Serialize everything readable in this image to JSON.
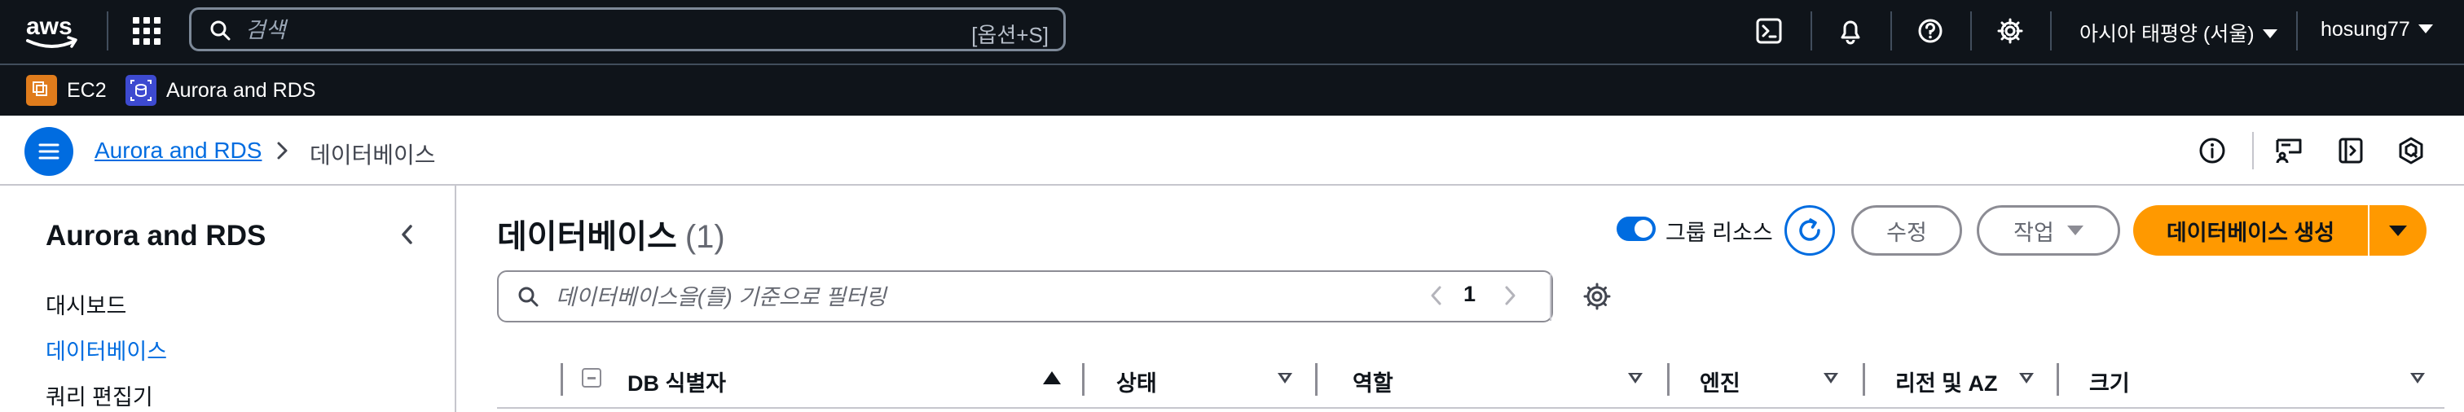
{
  "topnav": {
    "logo": "aws",
    "search_placeholder": "검색",
    "search_shortcut": "[옵션+S]",
    "icons": [
      "cloudshell-icon",
      "bell-icon",
      "help-icon",
      "gear-icon"
    ],
    "region": "아시아 태평양 (서울)",
    "user": "hosung77"
  },
  "favorites": [
    {
      "label": "EC2",
      "icon": "ec2-icon",
      "color": "#e07c1c"
    },
    {
      "label": "Aurora and RDS",
      "icon": "rds-icon",
      "color": "#3d4ad0"
    }
  ],
  "breadcrumb": {
    "parent": "Aurora and RDS",
    "current": "데이터베이스"
  },
  "sidenav": {
    "title": "Aurora and RDS",
    "items": [
      {
        "label": "대시보드",
        "active": false
      },
      {
        "label": "데이터베이스",
        "active": true
      },
      {
        "label": "쿼리 편집기",
        "active": false
      }
    ]
  },
  "main": {
    "title": "데이터베이스",
    "count": "(1)",
    "group_toggle_label": "그룹 리소스",
    "group_toggle_on": true,
    "modify_label": "수정",
    "actions_label": "작업",
    "create_label": "데이터베이스 생성",
    "filter_placeholder": "데이터베이스을(를) 기준으로 필터링",
    "page": "1",
    "columns": [
      "DB 식별자",
      "상태",
      "역할",
      "엔진",
      "리전 및 AZ",
      "크기"
    ]
  },
  "colors": {
    "nav_bg": "#0f141a",
    "accent": "#006ce0",
    "primary_button": "#ff9900"
  }
}
